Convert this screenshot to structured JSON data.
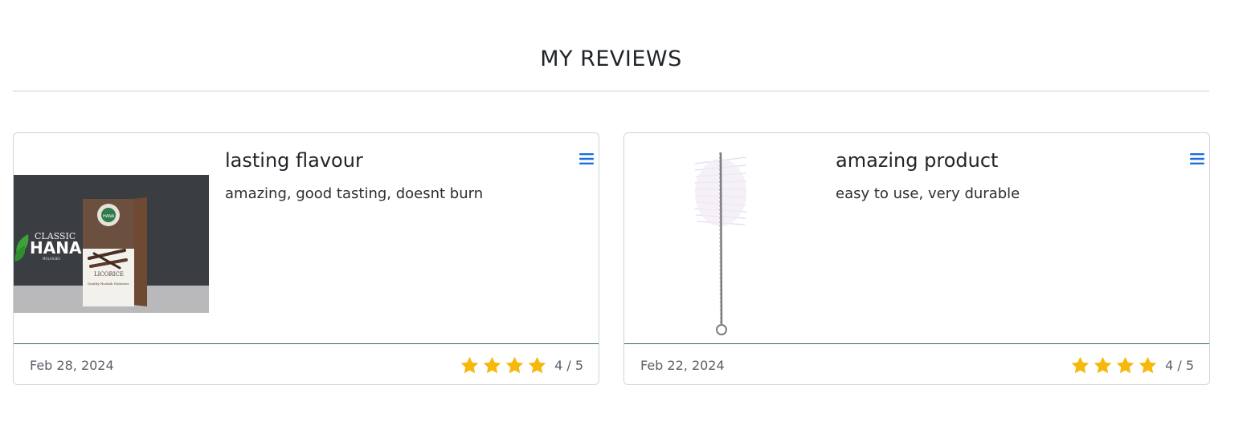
{
  "page": {
    "title": "MY REVIEWS"
  },
  "reviews": [
    {
      "title": "lasting flavour",
      "text": "amazing, good tasting, doesnt burn",
      "date": "Feb 28, 2024",
      "rating": 4,
      "rating_text": "4 / 5",
      "image": {
        "brand_line1": "CLASSIC",
        "brand_line2": "HANA",
        "brand_sub": "MOLASSES",
        "product": "LICORICE",
        "tagline": "Quality Hookah Molasses"
      }
    },
    {
      "title": "amazing product",
      "text": "easy to use, very durable",
      "date": "Feb 22, 2024",
      "rating": 4,
      "rating_text": "4 / 5"
    }
  ],
  "icons": {
    "menu": "hamburger-menu-icon",
    "star": "star-icon"
  },
  "colors": {
    "star": "#f5b80b",
    "menu_icon": "#1a6fe0",
    "footer_border": "#2e6f58"
  }
}
